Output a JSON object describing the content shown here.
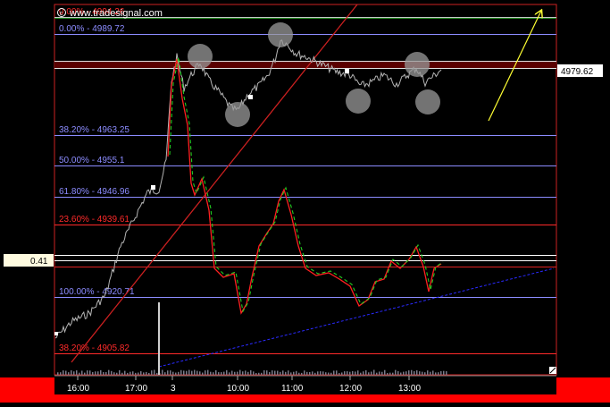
{
  "header": {
    "brand": "www.tradesignal.com",
    "brand_icon": "copyright-icon"
  },
  "chart_data": {
    "type": "line",
    "price_axis": {
      "label": "4979.62",
      "value": 4979.62
    },
    "indicator_axis": {
      "label": "0.41",
      "value": 0.41
    },
    "x_ticks": [
      "16:00",
      "17:00",
      "3",
      "10:00",
      "11:00",
      "12:00",
      "13:00"
    ],
    "fib_levels_upper": [
      {
        "label": "0.00% - 4994.26",
        "value": 4994.26,
        "color": "#ff2a2a"
      },
      {
        "label": "0.00% - 4989.72",
        "value": 4989.72,
        "color": "#8c8cff"
      },
      {
        "label": "38.20% - 4963.25",
        "value": 4963.25,
        "color": "#8c8cff"
      },
      {
        "label": "50.00% - 4955.1",
        "value": 4955.1,
        "color": "#8c8cff"
      },
      {
        "label": "61.80% - 4946.96",
        "value": 4946.96,
        "color": "#8c8cff"
      },
      {
        "label": "23.60% - 4939.61",
        "value": 4939.61,
        "color": "#ff2a2a"
      },
      {
        "label": "100.00% - 4920.71",
        "value": 4920.71,
        "color": "#8c8cff"
      },
      {
        "label": "38.20% - 4905.82",
        "value": 4905.82,
        "color": "#ff2a2a"
      }
    ],
    "ylim": [
      4897,
      4999
    ],
    "colors": {
      "price": "#b4b4b4",
      "indicator_fast": "#ff2020",
      "indicator_slow": "#22cc22",
      "trend_up": "#cc2020",
      "trend_dashed": "#2a2aff",
      "arrow": "#ffff33",
      "timeline_bar": "#ff0000",
      "blue_line": "#6464ff",
      "red_line": "#dd2222"
    }
  }
}
